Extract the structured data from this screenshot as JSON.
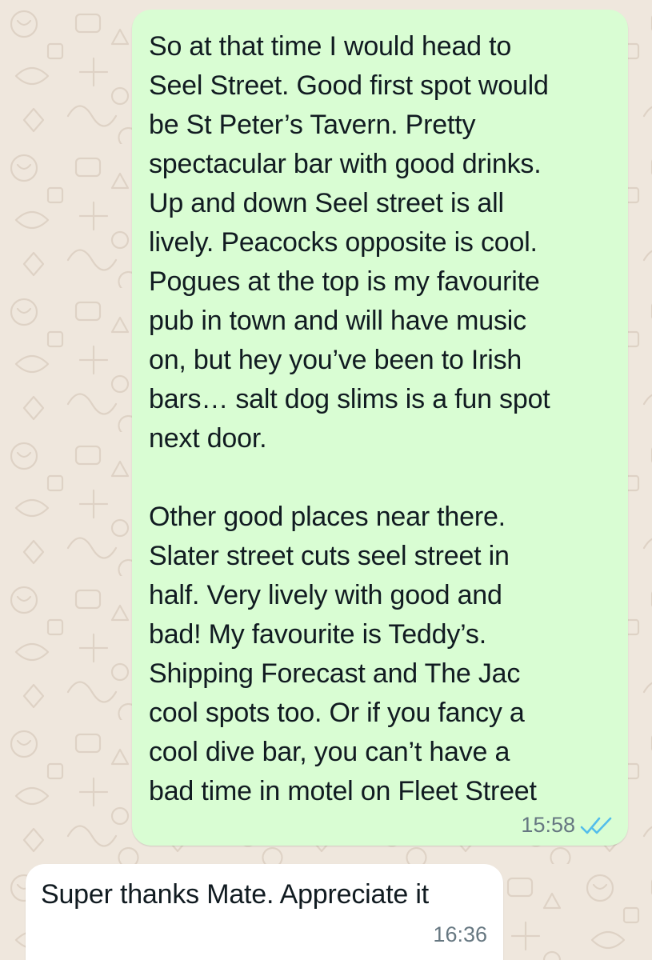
{
  "chat": {
    "messages": [
      {
        "direction": "outgoing",
        "paragraphs": [
          "So at that time I would head to\nSeel Street. Good first spot would\nbe St Peter’s Tavern. Pretty\nspectacular bar with good drinks.\nUp and down Seel street is all\nlively. Peacocks opposite is cool.\nPogues at the top is my favourite\npub in town and will have music\non, but hey you’ve been to Irish\nbars… salt dog slims is a fun spot\nnext door.",
          "Other good places near there.\nSlater street cuts seel street in\nhalf. Very lively with good and\nbad! My favourite is Teddy’s.\nShipping Forecast and The Jac\ncool spots too. Or if you fancy a\ncool dive bar, you can’t have a\nbad time in motel on Fleet Street"
        ],
        "time": "15:58",
        "status_icon": "double-check-read-icon"
      },
      {
        "direction": "incoming",
        "paragraphs": [
          "Super thanks Mate. Appreciate it"
        ],
        "time": "16:36"
      }
    ]
  },
  "colors": {
    "wallpaper": "#efe7dd",
    "outgoing_bubble": "#d9fdd3",
    "incoming_bubble": "#ffffff",
    "text": "#111b21",
    "meta_text": "#667781",
    "read_ticks": "#53bdeb"
  }
}
